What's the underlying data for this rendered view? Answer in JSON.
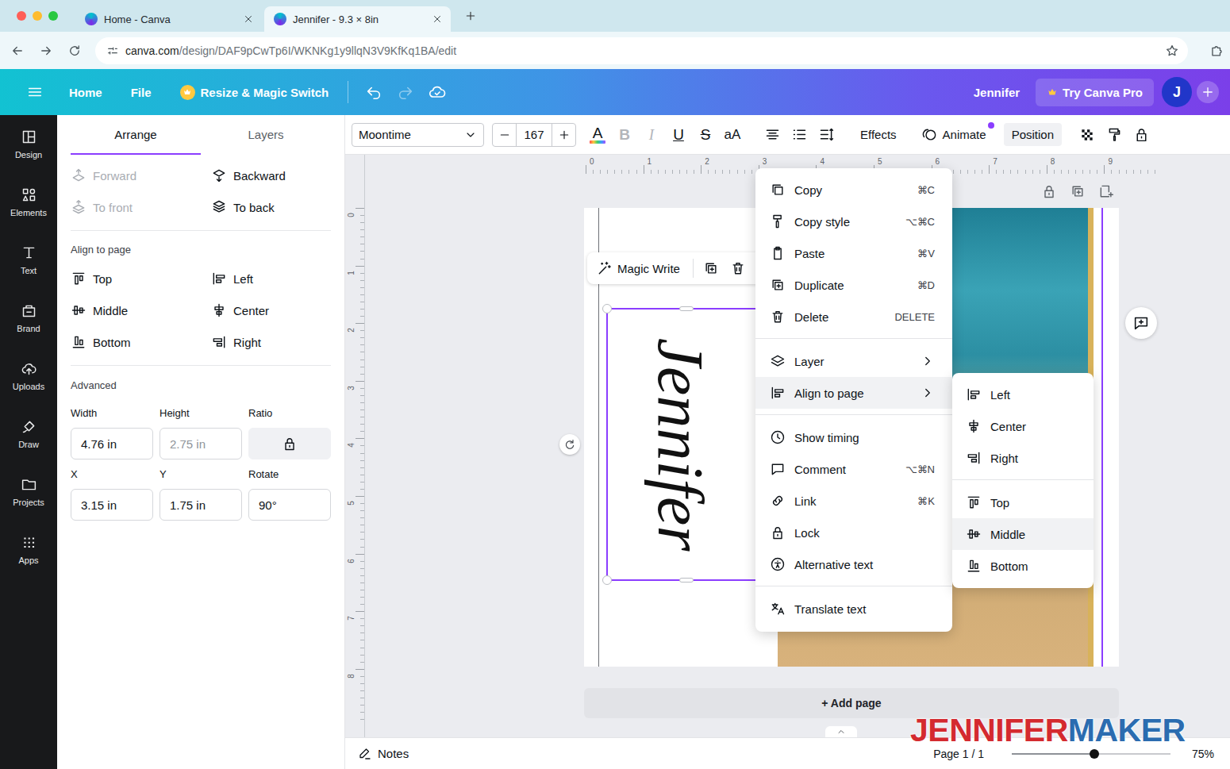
{
  "browser": {
    "tabs": [
      {
        "title": "Home - Canva",
        "selected": false
      },
      {
        "title": "Jennifer - 9.3 × 8in",
        "selected": true
      }
    ],
    "url": {
      "host": "canva.com",
      "path": "/design/DAF9pCwTp6I/WKNKg1y9llqN3V9KfKq1BA/edit"
    }
  },
  "header": {
    "nav": [
      "Home",
      "File"
    ],
    "resize": "Resize & Magic Switch",
    "undo_disabled": false,
    "redo_disabled": true,
    "user": "Jennifer",
    "pro": "Try Canva Pro",
    "avatar": "J"
  },
  "sidebar": {
    "items": [
      "Design",
      "Elements",
      "Text",
      "Brand",
      "Uploads",
      "Draw",
      "Projects",
      "Apps"
    ]
  },
  "panel": {
    "tabs": [
      {
        "label": "Arrange",
        "selected": true
      },
      {
        "label": "Layers",
        "selected": false
      }
    ],
    "order": [
      {
        "label": "Forward",
        "disabled": true
      },
      {
        "label": "Backward",
        "disabled": false
      },
      {
        "label": "To front",
        "disabled": true
      },
      {
        "label": "To back",
        "disabled": false
      }
    ],
    "align_title": "Align to page",
    "align": [
      "Top",
      "Left",
      "Middle",
      "Center",
      "Bottom",
      "Right"
    ],
    "advanced_title": "Advanced",
    "fields": [
      {
        "label": "Width",
        "value": "4.76 in",
        "disabled": false,
        "kind": "input"
      },
      {
        "label": "Height",
        "value": "2.75 in",
        "disabled": true,
        "kind": "input"
      },
      {
        "label": "Ratio",
        "disabled": false,
        "kind": "lock"
      },
      {
        "label": "X",
        "value": "3.15 in",
        "disabled": false,
        "kind": "input"
      },
      {
        "label": "Y",
        "value": "1.75 in",
        "disabled": false,
        "kind": "input"
      },
      {
        "label": "Rotate",
        "value": "90°",
        "disabled": false,
        "kind": "input"
      }
    ]
  },
  "toolbar": {
    "font": "Moontime",
    "size": "167",
    "format": [
      {
        "label": "A",
        "kind": "color",
        "disabled": false
      },
      {
        "label": "B",
        "kind": "bold",
        "disabled": true
      },
      {
        "label": "I",
        "kind": "italic",
        "disabled": true
      },
      {
        "label": "U",
        "kind": "underline",
        "disabled": false
      },
      {
        "label": "S",
        "kind": "strike",
        "disabled": false
      },
      {
        "label": "aA",
        "kind": "case",
        "disabled": false
      }
    ],
    "effects": "Effects",
    "animate": {
      "label": "Animate",
      "badge": true
    },
    "position": "Position"
  },
  "ruler": {
    "top": [
      "0",
      "1",
      "2",
      "3",
      "4",
      "5",
      "6",
      "7",
      "8",
      "9"
    ],
    "left": [
      "0",
      "1",
      "2",
      "3",
      "4",
      "5",
      "6",
      "7",
      "8"
    ]
  },
  "design": {
    "text": "Jennifer"
  },
  "magic_write": "Magic Write",
  "add_page": "+ Add page",
  "context_menu": {
    "groups": [
      [
        {
          "label": "Copy",
          "shortcut": "⌘C",
          "kind": "shortcut",
          "selected": false
        },
        {
          "label": "Copy style",
          "shortcut": "⌥⌘C",
          "kind": "shortcut",
          "selected": false
        },
        {
          "label": "Paste",
          "shortcut": "⌘V",
          "kind": "shortcut",
          "selected": false
        },
        {
          "label": "Duplicate",
          "shortcut": "⌘D",
          "kind": "shortcut",
          "selected": false
        },
        {
          "label": "Delete",
          "shortcut": "DELETE",
          "kind": "shortcut",
          "selected": false
        }
      ],
      [
        {
          "label": "Layer",
          "kind": "submenu",
          "selected": false
        },
        {
          "label": "Align to page",
          "kind": "submenu",
          "selected": true
        }
      ],
      [
        {
          "label": "Show timing",
          "kind": "plain",
          "selected": false
        },
        {
          "label": "Comment",
          "shortcut": "⌥⌘N",
          "kind": "shortcut",
          "selected": false
        },
        {
          "label": "Link",
          "shortcut": "⌘K",
          "kind": "shortcut",
          "selected": false
        },
        {
          "label": "Lock",
          "kind": "plain",
          "selected": false
        },
        {
          "label": "Alternative text",
          "kind": "plain",
          "selected": false
        }
      ],
      [
        {
          "label": "Translate text",
          "kind": "plain",
          "selected": false
        }
      ]
    ]
  },
  "submenu": {
    "groups": [
      [
        {
          "label": "Left",
          "selected": false
        },
        {
          "label": "Center",
          "selected": false
        },
        {
          "label": "Right",
          "selected": false
        }
      ],
      [
        {
          "label": "Top",
          "selected": false
        },
        {
          "label": "Middle",
          "selected": true
        },
        {
          "label": "Bottom",
          "selected": false
        }
      ]
    ]
  },
  "footer": {
    "notes": "Notes",
    "page": "Page 1 / 1",
    "zoom": {
      "level": 0.52,
      "reading": "75%"
    }
  },
  "watermark": {
    "parts": [
      {
        "text": "JENNIFER",
        "color": "#d42a2f"
      },
      {
        "text": "MAKER",
        "color": "#2b6cb0"
      }
    ]
  }
}
